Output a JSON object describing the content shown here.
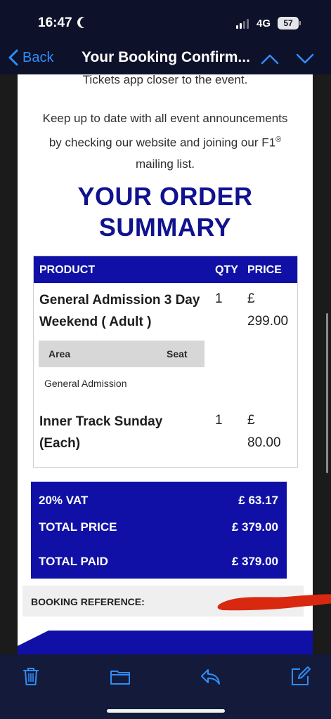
{
  "status_bar": {
    "time": "16:47",
    "network": "4G",
    "battery": "57"
  },
  "nav": {
    "back_label": "Back",
    "title": "Your Booking Confirm..."
  },
  "email": {
    "partial_line": "Tickets app closer to the event.",
    "announcement_line1": "Keep up to date with all event announcements",
    "announcement_line2": "by checking our website and joining our F1",
    "announcement_reg": "®",
    "announcement_line3": "mailing list.",
    "order_title_line1": "YOUR ORDER",
    "order_title_line2": "SUMMARY",
    "table_headers": {
      "product": "PRODUCT",
      "qty": "QTY",
      "price": "PRICE"
    },
    "products": [
      {
        "name_line1": "General Admission 3 Day",
        "name_line2": "Weekend ( Adult )",
        "qty": "1",
        "currency": "£",
        "amount": "299.00"
      },
      {
        "name_line1": "Inner Track Sunday",
        "name_line2": "(Each)",
        "qty": "1",
        "currency": "£",
        "amount": "80.00"
      }
    ],
    "area_table": {
      "area_header": "Area",
      "seat_header": "Seat",
      "area_value": "General Admission"
    },
    "totals": [
      {
        "label": "20% VAT",
        "value": "£ 63.17"
      },
      {
        "label": "TOTAL PRICE",
        "value": "£ 379.00"
      },
      {
        "label": "TOTAL PAID",
        "value": "£ 379.00"
      }
    ],
    "booking_reference_label": "BOOKING REFERENCE:"
  },
  "toolbar": {
    "icons": [
      "trash-icon",
      "folder-icon",
      "reply-icon",
      "compose-icon"
    ]
  },
  "colors": {
    "brand_blue": "#1010a6",
    "title_blue": "#10128f",
    "ios_link_blue": "#2f8dfb",
    "redaction_red": "#d8280f",
    "app_background": "#0d1129"
  }
}
